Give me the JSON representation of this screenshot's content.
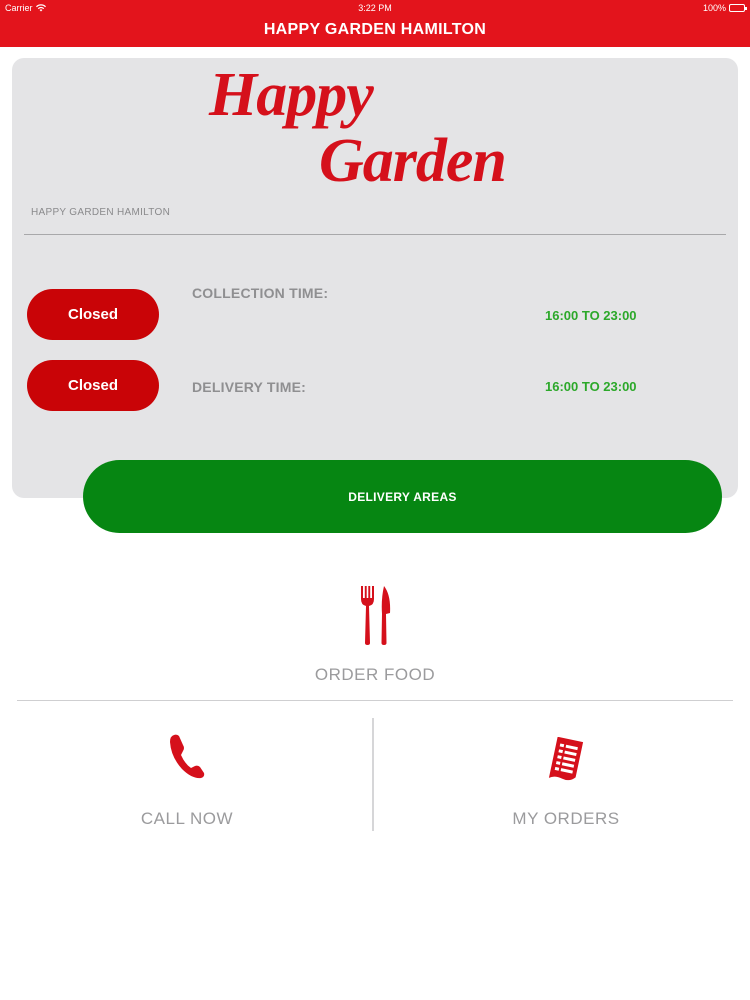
{
  "status_bar": {
    "carrier": "Carrier",
    "time": "3:22 PM",
    "battery": "100%"
  },
  "header": {
    "title": "HAPPY GARDEN HAMILTON"
  },
  "logo": {
    "line1": "Happy",
    "line2": "Garden"
  },
  "info": {
    "restaurant_name": "HAPPY GARDEN HAMILTON",
    "collection": {
      "status": "Closed",
      "label": "COLLECTION TIME:",
      "hours": "16:00 TO 23:00"
    },
    "delivery": {
      "status": "Closed",
      "label": "DELIVERY TIME:",
      "hours": "16:00 TO 23:00"
    }
  },
  "delivery_areas_label": "DELIVERY AREAS",
  "actions": {
    "order_food": "ORDER FOOD",
    "call_now": "CALL NOW",
    "my_orders": "MY ORDERS"
  },
  "icons": {
    "order_food": "fork-knife-icon",
    "call_now": "phone-icon",
    "my_orders": "receipt-icon"
  },
  "colors": {
    "brand_red": "#e3141c",
    "closed_red": "#c90407",
    "open_hours_green": "#2ca82a",
    "delivery_button_green": "#068612",
    "card_grey": "#e4e4e6"
  }
}
